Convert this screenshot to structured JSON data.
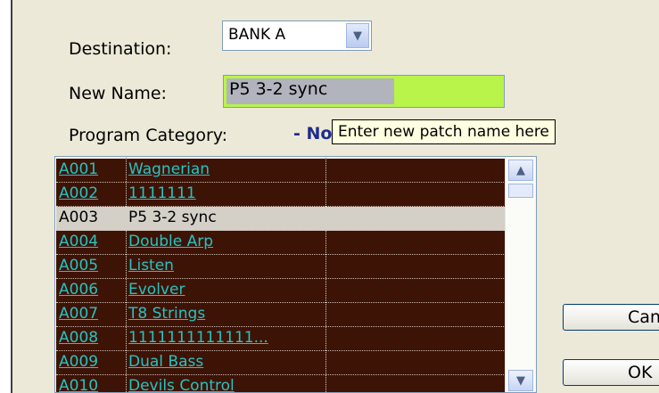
{
  "form": {
    "destination_label": "Destination:",
    "destination_value": "BANK A",
    "new_name_label": "New Name:",
    "new_name_value": "P5 3-2 sync",
    "program_category_label": "Program Category:",
    "program_category_value": "- No",
    "tooltip": "Enter new patch name here"
  },
  "programs": [
    {
      "id": "A001",
      "name": "Wagnerian",
      "selected": false
    },
    {
      "id": "A002",
      "name": "1111111",
      "selected": false
    },
    {
      "id": "A003",
      "name": "P5 3-2 sync",
      "selected": true
    },
    {
      "id": "A004",
      "name": "Double Arp",
      "selected": false
    },
    {
      "id": "A005",
      "name": "Listen",
      "selected": false
    },
    {
      "id": "A006",
      "name": "Evolver",
      "selected": false
    },
    {
      "id": "A007",
      "name": "T8 Strings",
      "selected": false
    },
    {
      "id": "A008",
      "name": "1111111111111...",
      "selected": false
    },
    {
      "id": "A009",
      "name": "Dual Bass",
      "selected": false
    },
    {
      "id": "A010",
      "name": "Devils Control",
      "selected": false
    }
  ],
  "buttons": {
    "cancel": "Cancel",
    "ok": "OK"
  },
  "icons": {
    "dropdown": "chevron-down-icon",
    "scroll_up": "chevron-up-icon",
    "scroll_down": "chevron-down-icon"
  }
}
